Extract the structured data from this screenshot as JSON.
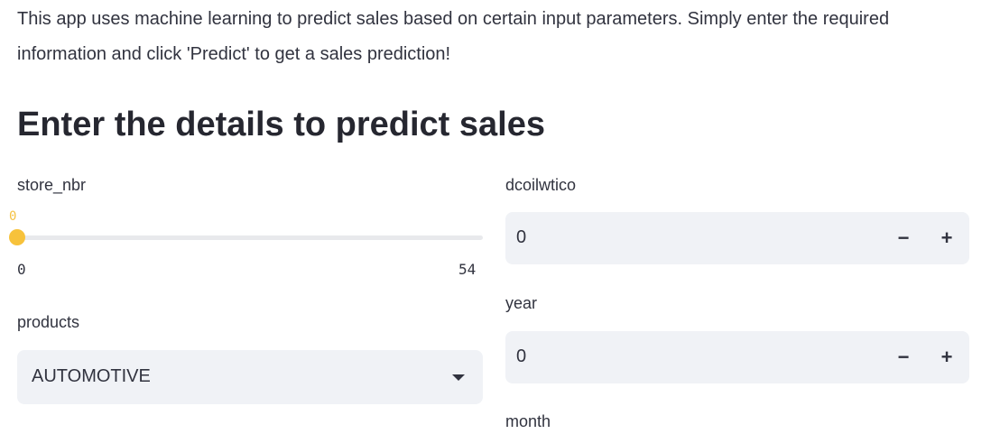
{
  "intro": {
    "text": "This app uses machine learning to predict sales based on certain input parameters. Simply enter the required information and click 'Predict' to get a sales prediction!"
  },
  "form": {
    "heading": "Enter the details to predict sales",
    "store_nbr": {
      "label": "store_nbr",
      "value": "0",
      "min": "0",
      "max": "54",
      "fraction": 0
    },
    "products": {
      "label": "products",
      "selected": "AUTOMOTIVE"
    },
    "dcoilwtico": {
      "label": "dcoilwtico",
      "value": "0",
      "decrement": "−",
      "increment": "+"
    },
    "year": {
      "label": "year",
      "value": "0",
      "decrement": "−",
      "increment": "+"
    },
    "month": {
      "label": "month"
    }
  },
  "colors": {
    "accent": "#F7C23B",
    "input_bg": "#F0F2F6",
    "text": "#31333F"
  },
  "icons": {
    "select_caret": "caret-down-icon",
    "decrement": "minus-icon",
    "increment": "plus-icon"
  }
}
